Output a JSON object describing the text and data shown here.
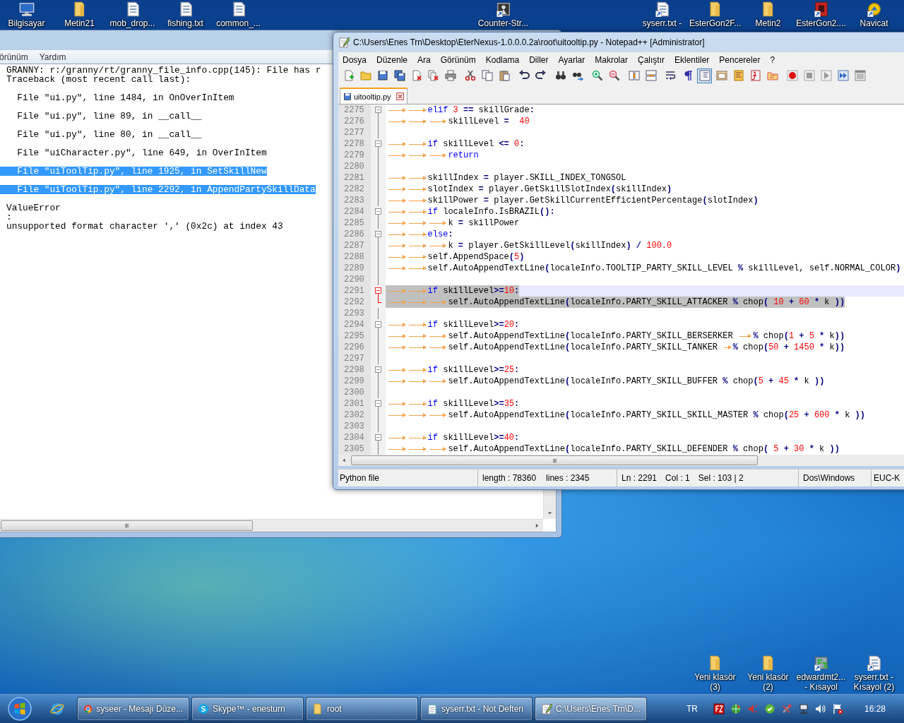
{
  "desktop_icons_top": [
    {
      "label": "Bilgisayar",
      "kind": "computer",
      "shortcut": false
    },
    {
      "label": "Metin21",
      "kind": "folder",
      "shortcut": false
    },
    {
      "label": "mob_drop...",
      "kind": "text-file",
      "shortcut": false
    },
    {
      "label": "fishing.txt",
      "kind": "text-file",
      "shortcut": false
    },
    {
      "label": "common_...",
      "kind": "text-file",
      "shortcut": false
    },
    {
      "label": "Counter-Str...",
      "kind": "game",
      "shortcut": true
    },
    {
      "label": "syserr.txt -",
      "kind": "text-file",
      "shortcut": true
    },
    {
      "label": "EsterGon2F...",
      "kind": "folder",
      "shortcut": false
    },
    {
      "label": "Metin2",
      "kind": "folder",
      "shortcut": false
    },
    {
      "label": "EsterGon2....",
      "kind": "app",
      "shortcut": true
    },
    {
      "label": "Navicat",
      "kind": "app-yellow",
      "shortcut": true
    }
  ],
  "desktop_icons_bottom": [
    {
      "label": "Yeni klasör (3)",
      "kind": "folder",
      "shortcut": false
    },
    {
      "label": "Yeni klasör (2)",
      "kind": "folder",
      "shortcut": false
    },
    {
      "label": "edwardmt2... - Kısayol",
      "kind": "app-green",
      "shortcut": true
    },
    {
      "label": "syserr.txt - Kısayol (2)",
      "kind": "text-file",
      "shortcut": true
    }
  ],
  "notepad": {
    "menu": [
      "örünüm",
      "Yardım"
    ],
    "lines": [
      {
        "kind": "plain",
        "text": "GRANNY: r:/granny/rt/granny_file_info.cpp(145): File has r",
        "selected": false
      },
      {
        "kind": "plain",
        "text": "Traceback (most recent call last):",
        "selected": false
      },
      {
        "kind": "spaced",
        "text": "  File \"ui.py\", line 1484, in OnOverInItem",
        "selected": false
      },
      {
        "kind": "spaced",
        "text": "  File \"ui.py\", line 89, in __call__",
        "selected": false
      },
      {
        "kind": "spaced",
        "text": "  File \"ui.py\", line 80, in __call__",
        "selected": false
      },
      {
        "kind": "spaced",
        "text": "  File \"uiCharacter.py\", line 649, in OverInItem",
        "selected": false
      },
      {
        "kind": "spaced",
        "text": "  File \"uiToolTip.py\", line 1925, in SetSkillNew",
        "selected": true
      },
      {
        "kind": "spaced",
        "text": "  File \"uiToolTip.py\", line 2292, in AppendPartySkillData",
        "selected": true
      },
      {
        "kind": "spaced",
        "text": "ValueError",
        "selected": false
      },
      {
        "kind": "plain",
        "text": ":",
        "selected": false
      },
      {
        "kind": "plain",
        "text": "unsupported format character ',' (0x2c) at index 43",
        "selected": false
      }
    ]
  },
  "editor_window": {
    "title": "C:\\Users\\Enes Trn\\Desktop\\EterNexus-1.0.0.0.2a\\root\\uitooltip.py - Notepad++ [Administrator]",
    "menu": [
      "Dosya",
      "Düzenle",
      "Ara",
      "Görünüm",
      "Kodlama",
      "Diller",
      "Ayarlar",
      "Makrolar",
      "Çalıştır",
      "Eklentiler",
      "Pencereler",
      "?"
    ],
    "toolbar": [
      {
        "buttons": [
          {
            "kind": "new",
            "selected": false
          },
          {
            "kind": "open",
            "selected": false
          },
          {
            "kind": "save",
            "selected": false
          },
          {
            "kind": "save-all",
            "selected": false
          },
          {
            "kind": "close",
            "selected": false
          },
          {
            "kind": "close-all",
            "selected": false
          },
          {
            "kind": "print",
            "selected": false
          }
        ]
      },
      {
        "buttons": [
          {
            "kind": "cut",
            "selected": false
          },
          {
            "kind": "copy",
            "selected": false
          },
          {
            "kind": "paste",
            "selected": false
          }
        ]
      },
      {
        "buttons": [
          {
            "kind": "undo",
            "selected": false
          },
          {
            "kind": "redo",
            "selected": false
          }
        ]
      },
      {
        "buttons": [
          {
            "kind": "find",
            "selected": false
          },
          {
            "kind": "replace",
            "selected": false
          }
        ]
      },
      {
        "buttons": [
          {
            "kind": "zoom-in",
            "selected": false
          },
          {
            "kind": "zoom-out",
            "selected": false
          }
        ]
      },
      {
        "buttons": [
          {
            "kind": "sync-v",
            "selected": false
          },
          {
            "kind": "sync-h",
            "selected": false
          }
        ]
      },
      {
        "buttons": [
          {
            "kind": "wrap",
            "selected": false
          },
          {
            "kind": "all-chars",
            "selected": false
          },
          {
            "kind": "indent-guide",
            "selected": true
          },
          {
            "kind": "panel",
            "selected": false
          },
          {
            "kind": "doc-map",
            "selected": false
          },
          {
            "kind": "func-list",
            "selected": false
          },
          {
            "kind": "folder-tree",
            "selected": false
          }
        ]
      },
      {
        "buttons": [
          {
            "kind": "record",
            "selected": false
          },
          {
            "kind": "stop",
            "selected": false
          },
          {
            "kind": "play",
            "selected": false
          },
          {
            "kind": "play-multi",
            "selected": false
          },
          {
            "kind": "save-macro",
            "selected": false
          }
        ]
      }
    ],
    "tabs": [
      {
        "label": "uitooltip.py",
        "selected": true
      }
    ],
    "lines": [
      {
        "number": "2275",
        "fold_start": true,
        "fold_end": false,
        "current": false,
        "selected": false,
        "tokens": [
          {
            "kind": "tab"
          },
          {
            "kind": "tab"
          },
          {
            "kind": "keyword",
            "text": "elif"
          },
          {
            "kind": "number",
            "text": " 3"
          },
          {
            "kind": "operator",
            "text": " =="
          },
          {
            "kind": "text",
            "text": " skillGrade"
          },
          {
            "kind": "operator",
            "text": ":"
          }
        ]
      },
      {
        "number": "2276",
        "fold_start": false,
        "fold_end": false,
        "current": false,
        "selected": false,
        "tokens": [
          {
            "kind": "tab"
          },
          {
            "kind": "tab"
          },
          {
            "kind": "tab"
          },
          {
            "kind": "text",
            "text": "skillLevel "
          },
          {
            "kind": "operator",
            "text": "="
          },
          {
            "kind": "number",
            "text": "  40"
          }
        ]
      },
      {
        "number": "2277",
        "fold_start": false,
        "fold_end": false,
        "current": false
      },
      {
        "number": "2278",
        "fold_start": true,
        "fold_end": false,
        "current": false,
        "selected": false,
        "tokens": [
          {
            "kind": "tab"
          },
          {
            "kind": "tab"
          },
          {
            "kind": "keyword",
            "text": "if"
          },
          {
            "kind": "text",
            "text": " skillLevel "
          },
          {
            "kind": "operator",
            "text": "<="
          },
          {
            "kind": "number",
            "text": " 0"
          },
          {
            "kind": "operator",
            "text": ":"
          }
        ]
      },
      {
        "number": "2279",
        "fold_start": false,
        "fold_end": false,
        "current": false,
        "selected": false,
        "tokens": [
          {
            "kind": "tab"
          },
          {
            "kind": "tab"
          },
          {
            "kind": "tab"
          },
          {
            "kind": "keyword",
            "text": "return"
          }
        ]
      },
      {
        "number": "2280",
        "fold_start": false,
        "fold_end": false,
        "current": false
      },
      {
        "number": "2281",
        "fold_start": false,
        "fold_end": false,
        "current": false,
        "selected": false,
        "tokens": [
          {
            "kind": "tab"
          },
          {
            "kind": "tab"
          },
          {
            "kind": "text",
            "text": "skillIndex "
          },
          {
            "kind": "operator",
            "text": "="
          },
          {
            "kind": "text",
            "text": " player.SKILL_INDEX_TONGSOL"
          }
        ]
      },
      {
        "number": "2282",
        "fold_start": false,
        "fold_end": false,
        "current": false,
        "selected": false,
        "tokens": [
          {
            "kind": "tab"
          },
          {
            "kind": "tab"
          },
          {
            "kind": "text",
            "text": "slotIndex "
          },
          {
            "kind": "operator",
            "text": "="
          },
          {
            "kind": "text",
            "text": " player.GetSkillSlotIndex"
          },
          {
            "kind": "operator",
            "text": "("
          },
          {
            "kind": "text",
            "text": "skillIndex"
          },
          {
            "kind": "operator",
            "text": ")"
          }
        ]
      },
      {
        "number": "2283",
        "fold_start": false,
        "fold_end": false,
        "current": false,
        "selected": false,
        "tokens": [
          {
            "kind": "tab"
          },
          {
            "kind": "tab"
          },
          {
            "kind": "text",
            "text": "skillPower "
          },
          {
            "kind": "operator",
            "text": "="
          },
          {
            "kind": "text",
            "text": " player.GetSkillCurrentEfficientPercentage"
          },
          {
            "kind": "operator",
            "text": "("
          },
          {
            "kind": "text",
            "text": "slotIndex"
          },
          {
            "kind": "operator",
            "text": ")"
          }
        ]
      },
      {
        "number": "2284",
        "fold_start": true,
        "fold_end": false,
        "current": false,
        "selected": false,
        "tokens": [
          {
            "kind": "tab"
          },
          {
            "kind": "tab"
          },
          {
            "kind": "keyword",
            "text": "if"
          },
          {
            "kind": "text",
            "text": " localeInfo.IsBRAZIL"
          },
          {
            "kind": "operator",
            "text": "():"
          }
        ]
      },
      {
        "number": "2285",
        "fold_start": false,
        "fold_end": false,
        "current": false,
        "selected": false,
        "tokens": [
          {
            "kind": "tab"
          },
          {
            "kind": "tab"
          },
          {
            "kind": "tab"
          },
          {
            "kind": "text",
            "text": "k "
          },
          {
            "kind": "operator",
            "text": "="
          },
          {
            "kind": "text",
            "text": " skillPower"
          }
        ]
      },
      {
        "number": "2286",
        "fold_start": true,
        "fold_end": false,
        "current": false,
        "selected": false,
        "tokens": [
          {
            "kind": "tab"
          },
          {
            "kind": "tab"
          },
          {
            "kind": "keyword",
            "text": "else"
          },
          {
            "kind": "operator",
            "text": ":"
          }
        ]
      },
      {
        "number": "2287",
        "fold_start": false,
        "fold_end": false,
        "current": false,
        "selected": false,
        "tokens": [
          {
            "kind": "tab"
          },
          {
            "kind": "tab"
          },
          {
            "kind": "tab"
          },
          {
            "kind": "text",
            "text": "k "
          },
          {
            "kind": "operator",
            "text": "="
          },
          {
            "kind": "text",
            "text": " player.GetSkillLevel"
          },
          {
            "kind": "operator",
            "text": "("
          },
          {
            "kind": "text",
            "text": "skillIndex"
          },
          {
            "kind": "operator",
            "text": ")"
          },
          {
            "kind": "operator",
            "text": " /"
          },
          {
            "kind": "number",
            "text": " 100.0"
          }
        ]
      },
      {
        "number": "2288",
        "fold_start": false,
        "fold_end": false,
        "current": false,
        "selected": false,
        "tokens": [
          {
            "kind": "tab"
          },
          {
            "kind": "tab"
          },
          {
            "kind": "text",
            "text": "self.AppendSpace"
          },
          {
            "kind": "operator",
            "text": "("
          },
          {
            "kind": "number",
            "text": "5"
          },
          {
            "kind": "operator",
            "text": ")"
          }
        ]
      },
      {
        "number": "2289",
        "fold_start": false,
        "fold_end": false,
        "current": false,
        "selected": false,
        "tokens": [
          {
            "kind": "tab"
          },
          {
            "kind": "tab"
          },
          {
            "kind": "text",
            "text": "self.AutoAppendTextLine"
          },
          {
            "kind": "operator",
            "text": "("
          },
          {
            "kind": "text",
            "text": "localeInfo.TOOLTIP_PARTY_SKILL_LEVEL "
          },
          {
            "kind": "operator",
            "text": "%"
          },
          {
            "kind": "text",
            "text": " skillLevel, self.NORMAL_COLOR"
          },
          {
            "kind": "operator",
            "text": ")"
          }
        ]
      },
      {
        "number": "2290",
        "fold_start": false,
        "fold_end": false,
        "current": false
      },
      {
        "number": "2291",
        "fold_start": true,
        "fold_end": false,
        "current": true,
        "selected": true,
        "tokens": [
          {
            "kind": "tab"
          },
          {
            "kind": "tab"
          },
          {
            "kind": "keyword",
            "text": "if"
          },
          {
            "kind": "text",
            "text": " skillLevel"
          },
          {
            "kind": "operator",
            "text": ">="
          },
          {
            "kind": "number",
            "text": "10"
          },
          {
            "kind": "operator",
            "text": ":"
          }
        ]
      },
      {
        "number": "2292",
        "fold_start": false,
        "fold_end": true,
        "current": false,
        "selected": true,
        "tokens": [
          {
            "kind": "tab"
          },
          {
            "kind": "tab"
          },
          {
            "kind": "tab"
          },
          {
            "kind": "text",
            "text": "self.AutoAppendTextLine"
          },
          {
            "kind": "operator",
            "text": "("
          },
          {
            "kind": "text",
            "text": "localeInfo.PARTY_SKILL_ATTACKER "
          },
          {
            "kind": "operator",
            "text": "%"
          },
          {
            "kind": "text",
            "text": " chop"
          },
          {
            "kind": "operator",
            "text": "("
          },
          {
            "kind": "number",
            "text": " 10"
          },
          {
            "kind": "operator",
            "text": " +"
          },
          {
            "kind": "number",
            "text": " 60"
          },
          {
            "kind": "operator",
            "text": " *"
          },
          {
            "kind": "text",
            "text": " k "
          },
          {
            "kind": "operator",
            "text": "))"
          }
        ]
      },
      {
        "number": "2293",
        "fold_start": false,
        "fold_end": false,
        "current": false
      },
      {
        "number": "2294",
        "fold_start": true,
        "fold_end": false,
        "current": false,
        "selected": false,
        "tokens": [
          {
            "kind": "tab"
          },
          {
            "kind": "tab"
          },
          {
            "kind": "keyword",
            "text": "if"
          },
          {
            "kind": "text",
            "text": " skillLevel"
          },
          {
            "kind": "operator",
            "text": ">="
          },
          {
            "kind": "number",
            "text": "20"
          },
          {
            "kind": "operator",
            "text": ":"
          }
        ]
      },
      {
        "number": "2295",
        "fold_start": false,
        "fold_end": false,
        "current": false,
        "selected": false,
        "tokens": [
          {
            "kind": "tab"
          },
          {
            "kind": "tab"
          },
          {
            "kind": "tab"
          },
          {
            "kind": "text",
            "text": "self.AutoAppendTextLine"
          },
          {
            "kind": "operator",
            "text": "("
          },
          {
            "kind": "text",
            "text": "localeInfo.PARTY_SKILL_BERSERKER "
          },
          {
            "kind": "tab"
          },
          {
            "kind": "operator",
            "text": "%"
          },
          {
            "kind": "text",
            "text": " chop"
          },
          {
            "kind": "operator",
            "text": "("
          },
          {
            "kind": "number",
            "text": "1"
          },
          {
            "kind": "operator",
            "text": " +"
          },
          {
            "kind": "number",
            "text": " 5"
          },
          {
            "kind": "operator",
            "text": " *"
          },
          {
            "kind": "text",
            "text": " k"
          },
          {
            "kind": "operator",
            "text": "))"
          }
        ]
      },
      {
        "number": "2296",
        "fold_start": false,
        "fold_end": false,
        "current": false,
        "selected": false,
        "tokens": [
          {
            "kind": "tab"
          },
          {
            "kind": "tab"
          },
          {
            "kind": "tab"
          },
          {
            "kind": "text",
            "text": "self.AutoAppendTextLine"
          },
          {
            "kind": "operator",
            "text": "("
          },
          {
            "kind": "text",
            "text": "localeInfo.PARTY_SKILL_TANKER "
          },
          {
            "kind": "tab"
          },
          {
            "kind": "operator",
            "text": "%"
          },
          {
            "kind": "text",
            "text": " chop"
          },
          {
            "kind": "operator",
            "text": "("
          },
          {
            "kind": "number",
            "text": "50"
          },
          {
            "kind": "operator",
            "text": " +"
          },
          {
            "kind": "number",
            "text": " 1450"
          },
          {
            "kind": "operator",
            "text": " *"
          },
          {
            "kind": "text",
            "text": " k"
          },
          {
            "kind": "operator",
            "text": "))"
          }
        ]
      },
      {
        "number": "2297",
        "fold_start": false,
        "fold_end": false,
        "current": false
      },
      {
        "number": "2298",
        "fold_start": true,
        "fold_end": false,
        "current": false,
        "selected": false,
        "tokens": [
          {
            "kind": "tab"
          },
          {
            "kind": "tab"
          },
          {
            "kind": "keyword",
            "text": "if"
          },
          {
            "kind": "text",
            "text": " skillLevel"
          },
          {
            "kind": "operator",
            "text": ">="
          },
          {
            "kind": "number",
            "text": "25"
          },
          {
            "kind": "operator",
            "text": ":"
          }
        ]
      },
      {
        "number": "2299",
        "fold_start": false,
        "fold_end": false,
        "current": false,
        "selected": false,
        "tokens": [
          {
            "kind": "tab"
          },
          {
            "kind": "tab"
          },
          {
            "kind": "tab"
          },
          {
            "kind": "text",
            "text": "self.AutoAppendTextLine"
          },
          {
            "kind": "operator",
            "text": "("
          },
          {
            "kind": "text",
            "text": "localeInfo.PARTY_SKILL_BUFFER "
          },
          {
            "kind": "operator",
            "text": "%"
          },
          {
            "kind": "text",
            "text": " chop"
          },
          {
            "kind": "operator",
            "text": "("
          },
          {
            "kind": "number",
            "text": "5"
          },
          {
            "kind": "operator",
            "text": " +"
          },
          {
            "kind": "number",
            "text": " 45"
          },
          {
            "kind": "operator",
            "text": " *"
          },
          {
            "kind": "text",
            "text": " k "
          },
          {
            "kind": "operator",
            "text": "))"
          }
        ]
      },
      {
        "number": "2300",
        "fold_start": false,
        "fold_end": false,
        "current": false
      },
      {
        "number": "2301",
        "fold_start": true,
        "fold_end": false,
        "current": false,
        "selected": false,
        "tokens": [
          {
            "kind": "tab"
          },
          {
            "kind": "tab"
          },
          {
            "kind": "keyword",
            "text": "if"
          },
          {
            "kind": "text",
            "text": " skillLevel"
          },
          {
            "kind": "operator",
            "text": ">="
          },
          {
            "kind": "number",
            "text": "35"
          },
          {
            "kind": "operator",
            "text": ":"
          }
        ]
      },
      {
        "number": "2302",
        "fold_start": false,
        "fold_end": false,
        "current": false,
        "selected": false,
        "tokens": [
          {
            "kind": "tab"
          },
          {
            "kind": "tab"
          },
          {
            "kind": "tab"
          },
          {
            "kind": "text",
            "text": "self.AutoAppendTextLine"
          },
          {
            "kind": "operator",
            "text": "("
          },
          {
            "kind": "text",
            "text": "localeInfo.PARTY_SKILL_SKILL_MASTER "
          },
          {
            "kind": "operator",
            "text": "%"
          },
          {
            "kind": "text",
            "text": " chop"
          },
          {
            "kind": "operator",
            "text": "("
          },
          {
            "kind": "number",
            "text": "25"
          },
          {
            "kind": "operator",
            "text": " +"
          },
          {
            "kind": "number",
            "text": " 600"
          },
          {
            "kind": "operator",
            "text": " *"
          },
          {
            "kind": "text",
            "text": " k "
          },
          {
            "kind": "operator",
            "text": "))"
          }
        ]
      },
      {
        "number": "2303",
        "fold_start": false,
        "fold_end": false,
        "current": false
      },
      {
        "number": "2304",
        "fold_start": true,
        "fold_end": false,
        "current": false,
        "selected": false,
        "tokens": [
          {
            "kind": "tab"
          },
          {
            "kind": "tab"
          },
          {
            "kind": "keyword",
            "text": "if"
          },
          {
            "kind": "text",
            "text": " skillLevel"
          },
          {
            "kind": "operator",
            "text": ">="
          },
          {
            "kind": "number",
            "text": "40"
          },
          {
            "kind": "operator",
            "text": ":"
          }
        ]
      },
      {
        "number": "2305",
        "fold_start": false,
        "fold_end": false,
        "current": false,
        "selected": false,
        "tokens": [
          {
            "kind": "tab"
          },
          {
            "kind": "tab"
          },
          {
            "kind": "tab"
          },
          {
            "kind": "text",
            "text": "self.AutoAppendTextLine"
          },
          {
            "kind": "operator",
            "text": "("
          },
          {
            "kind": "text",
            "text": "localeInfo.PARTY_SKILL_DEFENDER "
          },
          {
            "kind": "operator",
            "text": "%"
          },
          {
            "kind": "text",
            "text": " chop"
          },
          {
            "kind": "operator",
            "text": "("
          },
          {
            "kind": "number",
            "text": " 5"
          },
          {
            "kind": "operator",
            "text": " +"
          },
          {
            "kind": "number",
            "text": " 30"
          },
          {
            "kind": "operator",
            "text": " *"
          },
          {
            "kind": "text",
            "text": " k "
          },
          {
            "kind": "operator",
            "text": "))"
          }
        ]
      }
    ],
    "status_bar": [
      {
        "texts": [
          "Python file"
        ]
      },
      {
        "texts": [
          "length : 78360",
          "lines : 2345"
        ]
      },
      {
        "texts": [
          "Ln : 2291",
          "Col : 1",
          "Sel : 103 | 2"
        ]
      },
      {
        "texts": [
          "Dos\\Windows"
        ]
      },
      {
        "texts": [
          "EUC-K"
        ]
      }
    ]
  },
  "taskbar": {
    "pinned": [
      {
        "kind": "ie"
      }
    ],
    "tasks": [
      {
        "label": "syseer - Mesajı Düze...",
        "kind": "chrome",
        "selected": false
      },
      {
        "label": "Skype™ - enesturn",
        "kind": "skype",
        "selected": false
      },
      {
        "label": "root",
        "kind": "folder",
        "selected": false
      },
      {
        "label": "syserr.txt - Not Defteri",
        "kind": "notepad",
        "selected": false
      },
      {
        "label": "C:\\Users\\Enes Trn\\D...",
        "kind": "notepadpp",
        "selected": true
      }
    ],
    "language": "TR",
    "tray_icons": [
      {
        "kind": "server"
      },
      {
        "kind": "globe"
      },
      {
        "kind": "speaker"
      },
      {
        "kind": "shield"
      },
      {
        "kind": "tools"
      },
      {
        "kind": "network"
      },
      {
        "kind": "volume"
      },
      {
        "kind": "flag"
      }
    ],
    "clock": "16:28"
  }
}
